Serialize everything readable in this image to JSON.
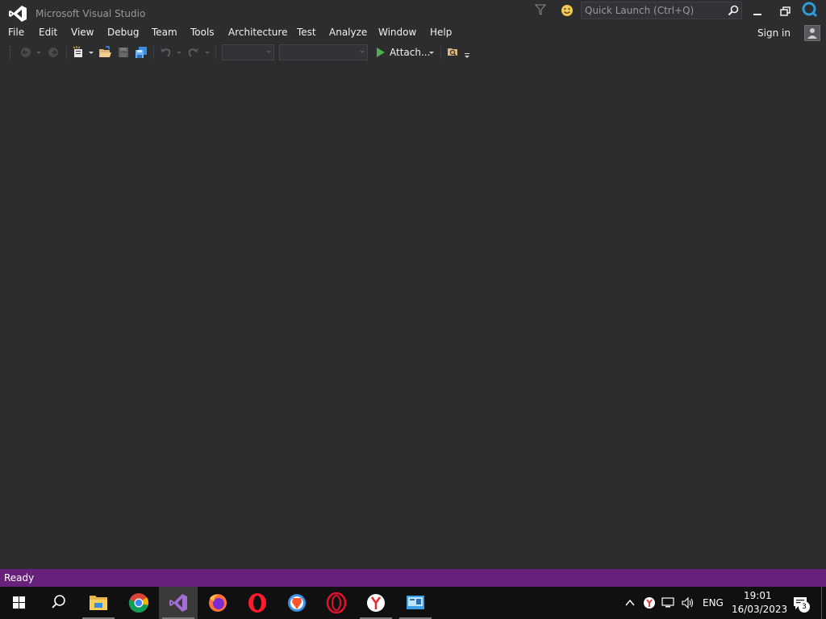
{
  "window": {
    "title": "Microsoft Visual Studio",
    "quick_launch_placeholder": "Quick Launch (Ctrl+Q)",
    "sign_in_label": "Sign in"
  },
  "menu": {
    "items": [
      {
        "label": "File"
      },
      {
        "label": "Edit"
      },
      {
        "label": "View"
      },
      {
        "label": "Debug"
      },
      {
        "label": "Team"
      },
      {
        "label": "Tools"
      },
      {
        "label": "Architecture"
      },
      {
        "label": "Test"
      },
      {
        "label": "Analyze"
      },
      {
        "label": "Window"
      },
      {
        "label": "Help"
      }
    ]
  },
  "toolbar": {
    "attach_label": "Attach...",
    "icons": [
      "navigate-back-icon",
      "navigate-forward-icon",
      "new-project-icon",
      "open-file-icon",
      "save-icon",
      "save-all-icon",
      "undo-icon",
      "redo-icon",
      "start-icon",
      "find-in-files-icon"
    ]
  },
  "status": {
    "text": "Ready"
  },
  "taskbar": {
    "apps": [
      "start-icon",
      "search-icon",
      "file-explorer-icon",
      "chrome-icon",
      "visual-studio-icon",
      "firefox-icon",
      "opera-icon",
      "brave-icon",
      "opera-gx-icon",
      "yandex-icon",
      "remote-desktop-icon"
    ],
    "tray": {
      "language": "ENG",
      "time": "19:01",
      "date": "16/03/2023",
      "notifications": "3"
    }
  },
  "colors": {
    "background": "#2d2d30",
    "status_bar": "#68217a",
    "taskbar": "#101010",
    "accent": "#68217a"
  }
}
